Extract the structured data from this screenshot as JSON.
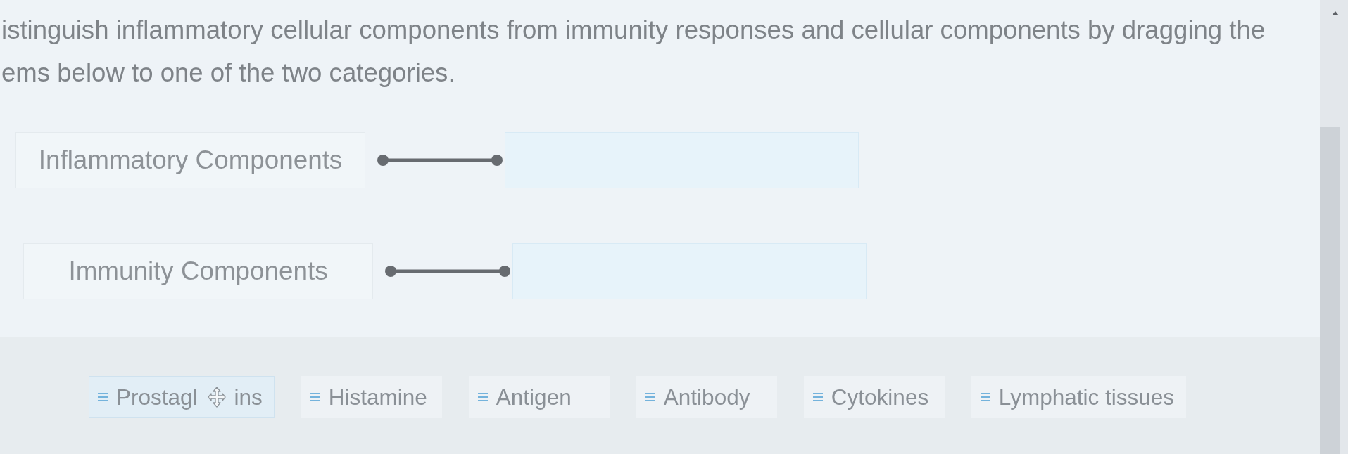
{
  "instructions": [
    {
      "text": "istinguish inflammatory cellular components from immunity responses and cellular components by dragging the"
    },
    {
      "text": "ems below to one of the two categories."
    }
  ],
  "categories": [
    {
      "label": "Inflammatory Components"
    },
    {
      "label": "Immunity Components"
    }
  ],
  "items": [
    {
      "label": "Prostagl",
      "label_after_cursor": "ins",
      "dragging": true
    },
    {
      "label": "Histamine",
      "dragging": false
    },
    {
      "label": "Antigen",
      "dragging": false
    },
    {
      "label": "Antibody",
      "dragging": false
    },
    {
      "label": "Cytokines",
      "dragging": false
    },
    {
      "label": "Lymphatic tissues",
      "dragging": false
    }
  ]
}
